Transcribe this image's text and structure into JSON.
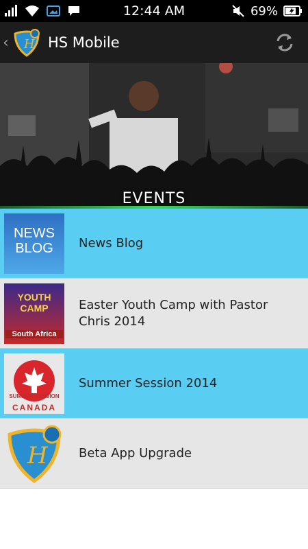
{
  "status_bar": {
    "time": "12:44 AM",
    "battery": "69%",
    "icons": [
      "signal-icon",
      "wifi-icon",
      "gallery-notification-icon",
      "chat-notification-icon",
      "mute-icon",
      "battery-icon"
    ]
  },
  "action_bar": {
    "title": "HS Mobile",
    "icons": [
      "back-chevron-icon",
      "app-logo",
      "refresh-icon"
    ]
  },
  "hero": {
    "label": "EVENTS"
  },
  "list": {
    "items": [
      {
        "label": "News Blog",
        "thumb_text": [
          "NEWS",
          "BLOG"
        ],
        "style": "blue"
      },
      {
        "label": "Easter Youth Camp with Pastor Chris 2014",
        "thumb_text": [
          "YOUTH",
          "CAMP",
          "South Africa"
        ],
        "style": "grey"
      },
      {
        "label": "Summer Session 2014",
        "thumb_text": [
          "SUMMER SESSION",
          "CANADA"
        ],
        "style": "blue"
      },
      {
        "label": "Beta App Upgrade",
        "thumb_text": [],
        "style": "grey"
      }
    ]
  },
  "colors": {
    "status_bar": "#000000",
    "action_bar": "#1d1d1d",
    "item_blue": "#59cdf2",
    "item_grey": "#e6e6e6",
    "logo_gold": "#f0b429",
    "logo_blue": "#2a8fd0"
  }
}
